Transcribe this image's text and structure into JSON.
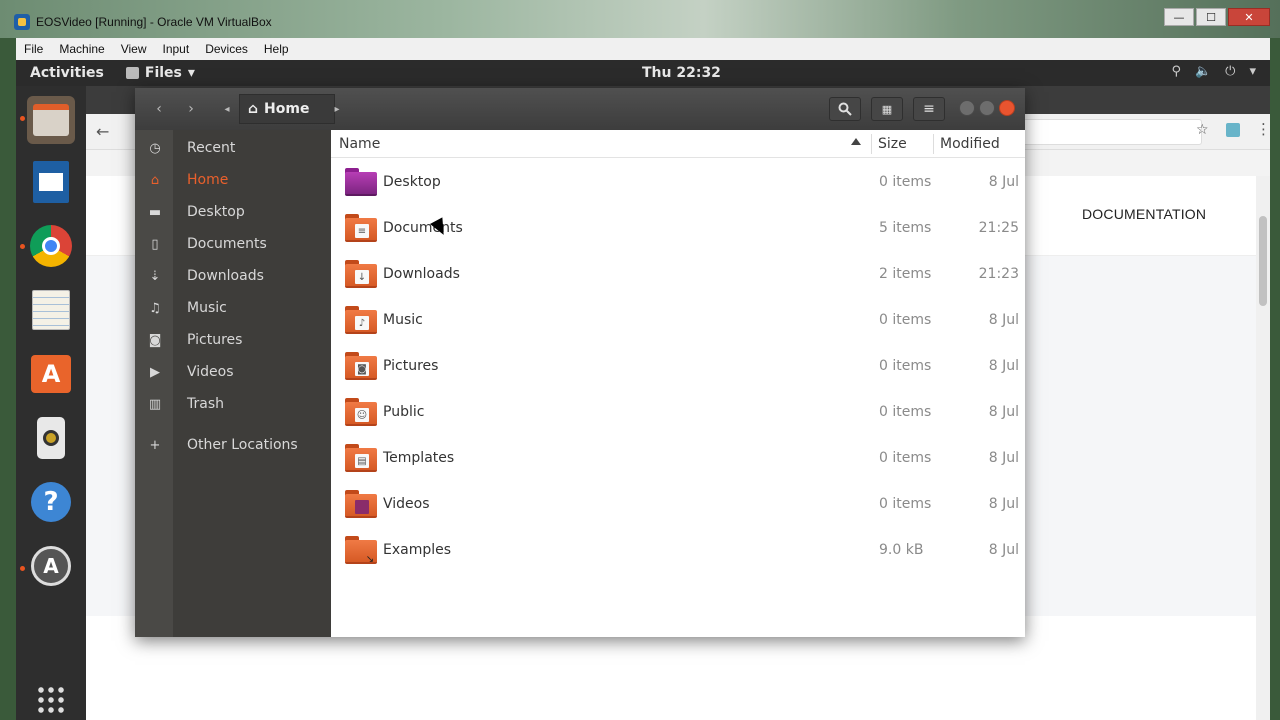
{
  "vbox": {
    "title": "EOSVideo [Running] - Oracle VM VirtualBox",
    "menu": [
      "File",
      "Machine",
      "View",
      "Input",
      "Devices",
      "Help"
    ],
    "controls": {
      "minimize": "—",
      "maximize": "☐",
      "close": "✕"
    }
  },
  "topbar": {
    "activities": "Activities",
    "app_menu": "Files",
    "clock": "Thu 22:32",
    "tray_icons": [
      "network-icon",
      "volume-icon",
      "power-icon",
      "chevron-down-icon"
    ]
  },
  "dock": {
    "apps": [
      "files",
      "libreoffice-writer",
      "chrome",
      "text-editor",
      "software-center",
      "speaker",
      "help",
      "software-updater",
      "show-apps"
    ]
  },
  "browser": {
    "nav_link": "DOCUMENTATION"
  },
  "nautilus": {
    "location": "Home",
    "sidebar": [
      {
        "label": "Recent",
        "icon": "clock-icon",
        "active": false
      },
      {
        "label": "Home",
        "icon": "home-icon",
        "active": true
      },
      {
        "label": "Desktop",
        "icon": "folder-icon",
        "active": false
      },
      {
        "label": "Documents",
        "icon": "document-icon",
        "active": false
      },
      {
        "label": "Downloads",
        "icon": "download-icon",
        "active": false
      },
      {
        "label": "Music",
        "icon": "music-icon",
        "active": false
      },
      {
        "label": "Pictures",
        "icon": "camera-icon",
        "active": false
      },
      {
        "label": "Videos",
        "icon": "video-icon",
        "active": false
      },
      {
        "label": "Trash",
        "icon": "trash-icon",
        "active": false
      },
      {
        "label": "Other Locations",
        "icon": "plus-icon",
        "active": false
      }
    ],
    "columns": {
      "name": "Name",
      "size": "Size",
      "modified": "Modified"
    },
    "files": [
      {
        "name": "Desktop",
        "size": "0 items",
        "modified": "8 Jul",
        "icon": "desktop-folder-icon"
      },
      {
        "name": "Documents",
        "size": "5 items",
        "modified": "21:25",
        "icon": "documents-folder-icon"
      },
      {
        "name": "Downloads",
        "size": "2 items",
        "modified": "21:23",
        "icon": "downloads-folder-icon"
      },
      {
        "name": "Music",
        "size": "0 items",
        "modified": "8 Jul",
        "icon": "music-folder-icon"
      },
      {
        "name": "Pictures",
        "size": "0 items",
        "modified": "8 Jul",
        "icon": "pictures-folder-icon"
      },
      {
        "name": "Public",
        "size": "0 items",
        "modified": "8 Jul",
        "icon": "public-folder-icon"
      },
      {
        "name": "Templates",
        "size": "0 items",
        "modified": "8 Jul",
        "icon": "templates-folder-icon"
      },
      {
        "name": "Videos",
        "size": "0 items",
        "modified": "8 Jul",
        "icon": "videos-folder-icon"
      },
      {
        "name": "Examples",
        "size": "9.0 kB",
        "modified": "8 Jul",
        "icon": "examples-folder-icon"
      }
    ]
  }
}
